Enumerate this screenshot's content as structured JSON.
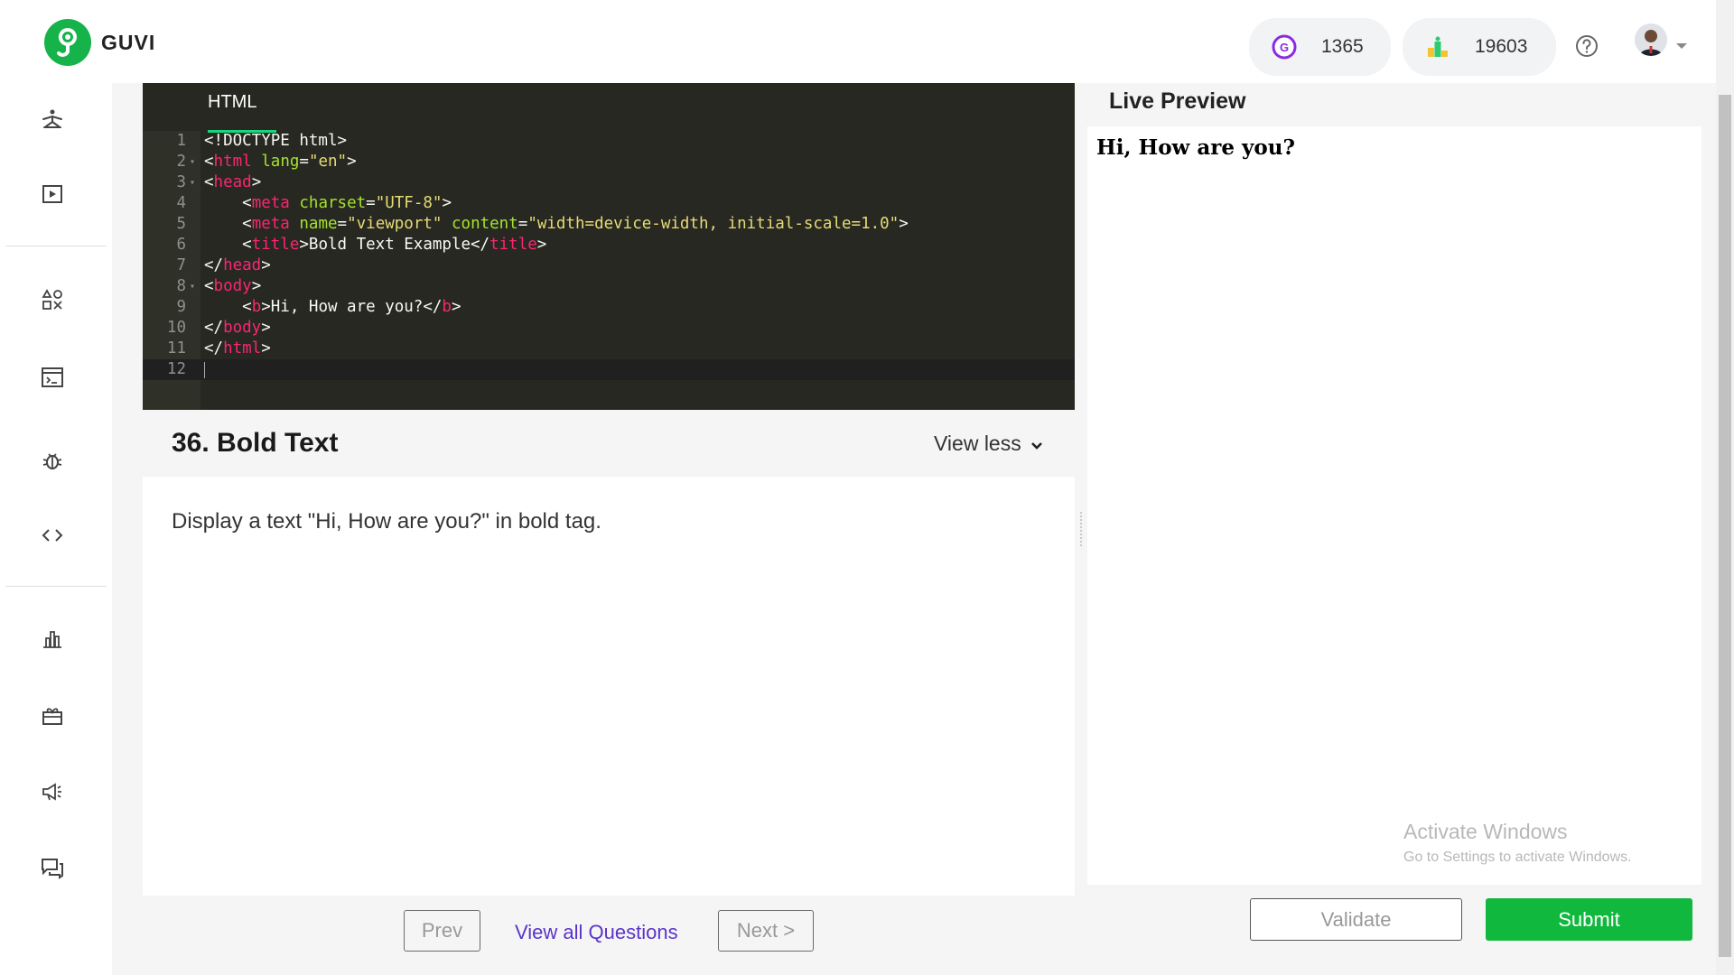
{
  "header": {
    "brand": "GUVI",
    "geekoins": "1365",
    "rank": "19603",
    "icons": [
      "guvi-logo-icon",
      "geekoin-icon",
      "leaderboard-icon",
      "help-icon",
      "avatar",
      "caret-down-icon"
    ]
  },
  "sidebar": {
    "icons": [
      "yoga-icon",
      "play-icon",
      "shapes-icon",
      "terminal-icon",
      "bug-icon",
      "code-icon",
      "bar-chart-icon",
      "gift-icon",
      "megaphone-icon",
      "chat-icon"
    ]
  },
  "editor": {
    "tab_label": "HTML",
    "lines": [
      {
        "n": "1",
        "tokens": [
          [
            "p",
            "<!DOCTYPE html>"
          ]
        ]
      },
      {
        "n": "2",
        "fold": true,
        "tokens": [
          [
            "p",
            "<"
          ],
          [
            "t",
            "html"
          ],
          [
            "p",
            " "
          ],
          [
            "a",
            "lang"
          ],
          [
            "p",
            "="
          ],
          [
            "s",
            "\"en\""
          ],
          [
            "p",
            ">"
          ]
        ]
      },
      {
        "n": "3",
        "fold": true,
        "tokens": [
          [
            "p",
            "<"
          ],
          [
            "t",
            "head"
          ],
          [
            "p",
            ">"
          ]
        ]
      },
      {
        "n": "4",
        "tokens": [
          [
            "p",
            "    <"
          ],
          [
            "t",
            "meta"
          ],
          [
            "p",
            " "
          ],
          [
            "a",
            "charset"
          ],
          [
            "p",
            "="
          ],
          [
            "s",
            "\"UTF-8\""
          ],
          [
            "p",
            ">"
          ]
        ]
      },
      {
        "n": "5",
        "tokens": [
          [
            "p",
            "    <"
          ],
          [
            "t",
            "meta"
          ],
          [
            "p",
            " "
          ],
          [
            "a",
            "name"
          ],
          [
            "p",
            "="
          ],
          [
            "s",
            "\"viewport\""
          ],
          [
            "p",
            " "
          ],
          [
            "a",
            "content"
          ],
          [
            "p",
            "="
          ],
          [
            "s",
            "\"width=device-width, initial-scale=1.0\""
          ],
          [
            "p",
            ">"
          ]
        ]
      },
      {
        "n": "6",
        "tokens": [
          [
            "p",
            "    <"
          ],
          [
            "t",
            "title"
          ],
          [
            "p",
            ">Bold Text Example</"
          ],
          [
            "t",
            "title"
          ],
          [
            "p",
            ">"
          ]
        ]
      },
      {
        "n": "7",
        "tokens": [
          [
            "p",
            "</"
          ],
          [
            "t",
            "head"
          ],
          [
            "p",
            ">"
          ]
        ]
      },
      {
        "n": "8",
        "fold": true,
        "tokens": [
          [
            "p",
            "<"
          ],
          [
            "t",
            "body"
          ],
          [
            "p",
            ">"
          ]
        ]
      },
      {
        "n": "9",
        "tokens": [
          [
            "p",
            "    <"
          ],
          [
            "t",
            "b"
          ],
          [
            "p",
            ">Hi, How are you?</"
          ],
          [
            "t",
            "b"
          ],
          [
            "p",
            ">"
          ]
        ]
      },
      {
        "n": "10",
        "tokens": [
          [
            "p",
            "</"
          ],
          [
            "t",
            "body"
          ],
          [
            "p",
            ">"
          ]
        ]
      },
      {
        "n": "11",
        "tokens": [
          [
            "p",
            "</"
          ],
          [
            "t",
            "html"
          ],
          [
            "p",
            ">"
          ]
        ]
      },
      {
        "n": "12",
        "active": true,
        "tokens": []
      }
    ]
  },
  "question": {
    "title": "36. Bold Text",
    "toggle_label": "View less",
    "description": "Display a text \"Hi, How are you?\" in bold tag."
  },
  "nav": {
    "prev_label": "Prev",
    "all_label": "View all Questions",
    "next_label": "Next >"
  },
  "preview": {
    "title": "Live Preview",
    "output_text": "Hi, How are you?",
    "watermark_line1": "Activate Windows",
    "watermark_line2": "Go to Settings to activate Windows."
  },
  "actions": {
    "validate_label": "Validate",
    "submit_label": "Submit"
  },
  "colors": {
    "brand_green": "#16b34a",
    "submit_green": "#11b83e",
    "link_purple": "#5b34c8",
    "editor_bg": "#272822"
  }
}
